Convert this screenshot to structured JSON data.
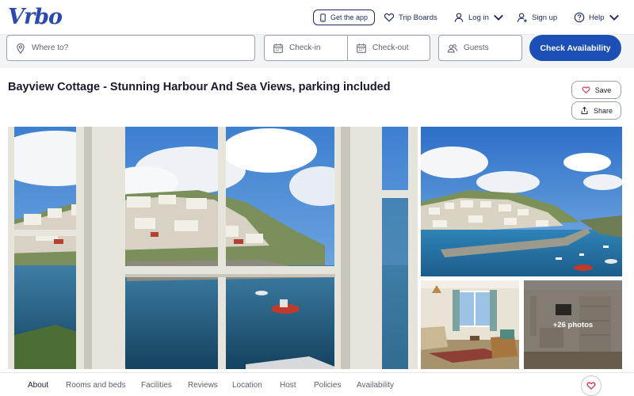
{
  "header": {
    "logo": "Vrbo",
    "get_app": "Get the app",
    "trip_boards": "Trip Boards",
    "log_in": "Log in",
    "sign_up": "Sign up",
    "help": "Help"
  },
  "search": {
    "destination_placeholder": "Where to?",
    "check_in": "Check-in",
    "check_out": "Check-out",
    "guests": "Guests",
    "submit": "Check Availability"
  },
  "listing": {
    "title": "Bayview Cottage - Stunning Harbour And Sea Views, parking included",
    "save": "Save",
    "share": "Share",
    "more_photos": "+26 photos"
  },
  "tabs": [
    "About",
    "Rooms and beds",
    "Facilities",
    "Reviews",
    "Location",
    "Host",
    "Policies",
    "Availability"
  ],
  "icons": {
    "get_app": "phone-icon",
    "trip_boards": "heart-icon",
    "log_in": "user-icon",
    "sign_up": "user-add-icon",
    "help": "help-circle-icon",
    "destination": "location-pin-icon",
    "dates": "calendar-icon",
    "guests": "people-icon",
    "save": "heart-icon",
    "share": "share-icon"
  },
  "colors": {
    "brand": "#2c49b0",
    "primary_button": "#1c4fb5",
    "nav_text": "#1b2a5c",
    "heart": "#d0243a"
  }
}
